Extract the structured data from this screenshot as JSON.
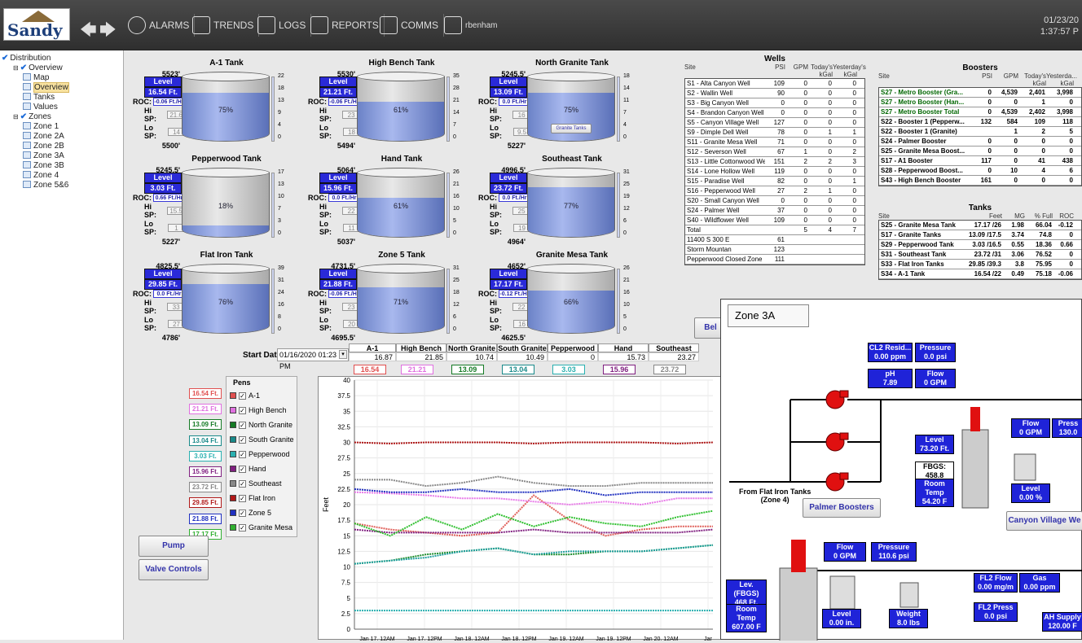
{
  "header": {
    "logo": "Sandy",
    "nav": [
      "ALARMS",
      "TRENDS",
      "LOGS",
      "REPORTS",
      "COMMS"
    ],
    "user": "rbenham",
    "date": "01/23/20",
    "time": "1:37:57 P"
  },
  "tree": [
    {
      "t": "Distribution",
      "lv": 0,
      "k": "check"
    },
    {
      "t": "Overview",
      "lv": 1,
      "k": "check"
    },
    {
      "t": "Map",
      "lv": 2,
      "k": "page"
    },
    {
      "t": "Overview",
      "lv": 2,
      "k": "page",
      "sel": true
    },
    {
      "t": "Tanks",
      "lv": 2,
      "k": "page"
    },
    {
      "t": "Values",
      "lv": 2,
      "k": "page"
    },
    {
      "t": "Zones",
      "lv": 1,
      "k": "check"
    },
    {
      "t": "Zone 1",
      "lv": 2,
      "k": "page"
    },
    {
      "t": "Zone 2A",
      "lv": 2,
      "k": "page"
    },
    {
      "t": "Zone 2B",
      "lv": 2,
      "k": "page"
    },
    {
      "t": "Zone 3A",
      "lv": 2,
      "k": "page"
    },
    {
      "t": "Zone 3B",
      "lv": 2,
      "k": "page"
    },
    {
      "t": "Zone 4",
      "lv": 2,
      "k": "page"
    },
    {
      "t": "Zone 5&6",
      "lv": 2,
      "k": "page"
    }
  ],
  "tanks": [
    {
      "name": "A-1 Tank",
      "top": "5523'",
      "level": "16.54 Ft.",
      "roc": "-0.06 Ft./Hr",
      "hisp": "21.6",
      "losp": "14",
      "bottom": "5500'",
      "pct": "75%",
      "fill": 0.75,
      "scale": [
        "22",
        "18",
        "13",
        "9",
        "4",
        "0"
      ]
    },
    {
      "name": "High Bench Tank",
      "top": "5530'",
      "level": "21.21 Ft.",
      "roc": "-0.06 Ft./Hr",
      "hisp": "23",
      "losp": "18",
      "bottom": "5494'",
      "pct": "61%",
      "fill": 0.61,
      "scale": [
        "35",
        "28",
        "21",
        "14",
        "7",
        "0"
      ]
    },
    {
      "name": "North Granite Tank",
      "top": "5245.5'",
      "level": "13.09 Ft.",
      "roc": "0.0 Ft./Hr",
      "hisp": "16",
      "losp": "9.5",
      "bottom": "5227'",
      "pct": "75%",
      "fill": 0.75,
      "scale": [
        "18",
        "14",
        "11",
        "7",
        "4",
        "0"
      ],
      "btn": "Granite Tanks"
    },
    {
      "name": "Pepperwood Tank",
      "top": "5245.5'",
      "level": "3.03 Ft.",
      "roc": "0.66 Ft./Hr",
      "hisp": "15.5",
      "losp": "1",
      "bottom": "5227'",
      "pct": "18%",
      "fill": 0.18,
      "scale": [
        "17",
        "13",
        "10",
        "7",
        "3",
        "0"
      ]
    },
    {
      "name": "Hand Tank",
      "top": "5064'",
      "level": "15.96 Ft.",
      "roc": "0.0 Ft./Hr",
      "hisp": "22",
      "losp": "11",
      "bottom": "5037'",
      "pct": "61%",
      "fill": 0.61,
      "scale": [
        "26",
        "21",
        "16",
        "10",
        "5",
        "0"
      ]
    },
    {
      "name": "Southeast Tank",
      "top": "4996.5'",
      "level": "23.72 Ft.",
      "roc": "0.0 Ft./Hr",
      "hisp": "25",
      "losp": "19",
      "bottom": "4964'",
      "pct": "77%",
      "fill": 0.77,
      "scale": [
        "31",
        "25",
        "19",
        "12",
        "6",
        "0"
      ]
    },
    {
      "name": "Flat Iron Tank",
      "top": "4825.5'",
      "level": "29.85 Ft.",
      "roc": "0.0 Ft./Hr",
      "hisp": "33",
      "losp": "27",
      "bottom": "4786'",
      "pct": "76%",
      "fill": 0.76,
      "scale": [
        "39",
        "31",
        "24",
        "16",
        "8",
        "0"
      ]
    },
    {
      "name": "Zone 5 Tank",
      "top": "4731.5'",
      "level": "21.88 Ft.",
      "roc": "-0.06 Ft./Hr",
      "hisp": "23",
      "losp": "20",
      "bottom": "4695.5'",
      "pct": "71%",
      "fill": 0.71,
      "scale": [
        "31",
        "25",
        "18",
        "12",
        "6",
        "0"
      ]
    },
    {
      "name": "Granite Mesa Tank",
      "top": "4652'",
      "level": "17.17 Ft.",
      "roc": "-0.12 Ft./Hr",
      "hisp": "22",
      "losp": "16",
      "bottom": "4625.5'",
      "pct": "66%",
      "fill": 0.66,
      "scale": [
        "26",
        "21",
        "16",
        "10",
        "5",
        "0"
      ]
    }
  ],
  "wells": {
    "title": "Wells",
    "hdr": [
      "Site",
      "PSI",
      "GPM",
      "Today's kGal",
      "Yesterday's kGal"
    ],
    "rows": [
      [
        "S1 - Alta Canyon Well",
        "109",
        "0",
        "0",
        "0"
      ],
      [
        "S2 - Wallin Well",
        "90",
        "0",
        "0",
        "0"
      ],
      [
        "S3 - Big Canyon Well",
        "0",
        "0",
        "0",
        "0"
      ],
      [
        "S4 - Brandon Canyon Well",
        "0",
        "0",
        "0",
        "0"
      ],
      [
        "S5 - Canyon Village Well",
        "127",
        "0",
        "0",
        "0"
      ],
      [
        "S9 - Dimple Dell Well",
        "78",
        "0",
        "1",
        "1"
      ],
      [
        "S11 - Granite Mesa Well",
        "71",
        "0",
        "0",
        "0"
      ],
      [
        "S12 - Severson Well",
        "67",
        "1",
        "0",
        "2"
      ],
      [
        "S13 - Little Cottonwood Well",
        "151",
        "2",
        "2",
        "3"
      ],
      [
        "S14 - Lone Hollow Well",
        "119",
        "0",
        "0",
        "0"
      ],
      [
        "S15 - Paradise Well",
        "82",
        "0",
        "0",
        "1"
      ],
      [
        "S16 - Pepperwood Well",
        "27",
        "2",
        "1",
        "0"
      ],
      [
        "S20 - Small Canyon Well",
        "0",
        "0",
        "0",
        "0"
      ],
      [
        "S24 - Palmer Well",
        "37",
        "0",
        "0",
        "0"
      ],
      [
        "S40 - Wildflower Well",
        "109",
        "0",
        "0",
        "0"
      ],
      [
        "Total",
        "",
        "5",
        "4",
        "7"
      ],
      [
        "11400 S 300 E",
        "61",
        "",
        "",
        ""
      ],
      [
        "Storm Mountan",
        "123",
        "",
        "",
        ""
      ],
      [
        "Pepperwood Closed Zone",
        "111",
        "",
        "",
        ""
      ]
    ]
  },
  "boosters": {
    "title": "Boosters",
    "hdr": [
      "Site",
      "PSI",
      "GPM",
      "Today's kGal",
      "Yesterda... kGal"
    ],
    "rows": [
      [
        "S27 - Metro Booster (Gra...",
        "0",
        "4,539",
        "2,401",
        "3,998"
      ],
      [
        "S27 - Metro Booster (Han...",
        "0",
        "0",
        "1",
        "0"
      ],
      [
        "S27 - Metro Booster Total",
        "0",
        "4,539",
        "2,402",
        "3,998"
      ],
      [
        "S22 - Booster 1 (Pepperw...",
        "132",
        "584",
        "109",
        "118"
      ],
      [
        "S22 - Booster 1 (Granite)",
        "",
        "1",
        "2",
        "5"
      ],
      [
        "S24 - Palmer Booster",
        "0",
        "0",
        "0",
        "0"
      ],
      [
        "S25 - Granite Mesa Boost...",
        "0",
        "0",
        "0",
        "0"
      ],
      [
        "S17 - A1 Booster",
        "117",
        "0",
        "41",
        "438"
      ],
      [
        "S28 - Pepperwood Boost...",
        "0",
        "10",
        "4",
        "6"
      ],
      [
        "S43 - High Bench Booster",
        "161",
        "0",
        "0",
        "0"
      ]
    ]
  },
  "tanks_tbl": {
    "title": "Tanks",
    "hdr": [
      "Site",
      "Feet",
      "MG",
      "% Full",
      "ROC"
    ],
    "rows": [
      [
        "S25 - Granite Mesa Tank",
        "17.17 /26",
        "1.98",
        "66.04",
        "-0.12"
      ],
      [
        "S17 - Granite Tanks",
        "13.09 /17.5",
        "3.74",
        "74.8",
        "0"
      ],
      [
        "S29 - Pepperwood Tank",
        "3.03 /16.5",
        "0.55",
        "18.36",
        "0.66"
      ],
      [
        "S31 - Southeast Tank",
        "23.72 /31",
        "3.06",
        "76.52",
        "0"
      ],
      [
        "S33 - Flat Iron Tanks",
        "29.85 /39.3",
        "3.8",
        "75.95",
        "0"
      ],
      [
        "S34 - A-1 Tank",
        "16.54 /22",
        "0.49",
        "75.18",
        "-0.06"
      ]
    ]
  },
  "trend": {
    "start_label": "Start Date:",
    "start_value": "01/16/2020 01:23 PM",
    "pens_label": "Pens",
    "ylabel": "Feet",
    "cols": [
      "A-1",
      "High Bench",
      "North Granite",
      "South Granite",
      "Pepperwood",
      "Hand",
      "Southeast"
    ],
    "avg": [
      "16.87",
      "21.85",
      "10.74",
      "10.49",
      "0",
      "15.73",
      "23.27"
    ],
    "cur": [
      "16.54",
      "21.21",
      "13.09",
      "13.04",
      "3.03",
      "15.96",
      "23.72"
    ]
  },
  "buttons": {
    "pump": "Pump Sequencing",
    "valve": "Valve Controls",
    "bel": "Bel"
  },
  "chart_data": {
    "type": "line",
    "ylabel": "Feet",
    "ylim": [
      0,
      40
    ],
    "yticks": [
      "0",
      "2.5",
      "5",
      "7.5",
      "10",
      "12.5",
      "15",
      "17.5",
      "20",
      "22.5",
      "25",
      "27.5",
      "30",
      "32.5",
      "35",
      "37.5",
      "40"
    ],
    "xticks": [
      "Jan 17, 12AM",
      "Jan 17, 12PM",
      "Jan 18, 12AM",
      "Jan 18, 12PM",
      "Jan 19, 12AM",
      "Jan 19, 12PM",
      "Jan 20, 12AM",
      "Jar"
    ],
    "series": [
      {
        "name": "A-1",
        "color": "#e0605a",
        "values": [
          17,
          16,
          15.5,
          15,
          15.5,
          21.5,
          17.5,
          15,
          16,
          16.5,
          16.5
        ]
      },
      {
        "name": "High Bench",
        "color": "#e87ae8",
        "values": [
          22,
          21.8,
          21.5,
          21,
          21,
          20.5,
          20,
          20.5,
          20,
          21,
          21
        ]
      },
      {
        "name": "North Granite",
        "color": "#1a8a2a",
        "values": [
          10.5,
          11,
          12,
          12.5,
          13,
          12,
          12,
          12.5,
          12.5,
          13,
          13.5
        ]
      },
      {
        "name": "South Granite",
        "color": "#22a0a0",
        "values": [
          10.5,
          11,
          11.5,
          12.5,
          13,
          12,
          12.5,
          12.5,
          12.5,
          13,
          13.5
        ]
      },
      {
        "name": "Pepperwood",
        "color": "#2ab0b0",
        "values": [
          3,
          3,
          3,
          3,
          3,
          3,
          3,
          3,
          3,
          3,
          3
        ]
      },
      {
        "name": "Hand",
        "color": "#802080",
        "values": [
          16,
          15.5,
          15.5,
          15.5,
          15.5,
          16,
          15.5,
          15.5,
          15.5,
          15.5,
          16
        ]
      },
      {
        "name": "Southeast",
        "color": "#888888",
        "values": [
          24,
          24,
          23,
          23.5,
          24.5,
          23.5,
          23,
          23,
          23.5,
          23.5,
          23.5
        ]
      },
      {
        "name": "Flat Iron",
        "color": "#b01818",
        "values": [
          30,
          29.8,
          30,
          30,
          30,
          29.8,
          30,
          30,
          30,
          29.8,
          30
        ]
      },
      {
        "name": "Zone 5",
        "color": "#2030c0",
        "values": [
          22.5,
          22,
          22,
          22.5,
          22,
          22,
          22.5,
          21.5,
          22,
          22,
          22
        ]
      },
      {
        "name": "Granite Mesa",
        "color": "#30c030",
        "values": [
          17,
          15,
          18,
          16,
          18.5,
          16.5,
          18,
          17,
          16.5,
          18,
          19
        ]
      }
    ]
  },
  "pens": [
    {
      "name": "A-1",
      "val": "16.54 Ft.",
      "color": "#e05050"
    },
    {
      "name": "High Bench",
      "val": "21.21 Ft.",
      "color": "#e070e0"
    },
    {
      "name": "North Granite",
      "val": "13.09 Ft.",
      "color": "#157a25"
    },
    {
      "name": "South Granite",
      "val": "13.04 Ft.",
      "color": "#1a8a8a"
    },
    {
      "name": "Pepperwood",
      "val": "3.03 Ft.",
      "color": "#2ab0b0"
    },
    {
      "name": "Hand",
      "val": "15.96 Ft.",
      "color": "#802080"
    },
    {
      "name": "Southeast",
      "val": "23.72 Ft.",
      "color": "#888888"
    },
    {
      "name": "Flat Iron",
      "val": "29.85 Ft.",
      "color": "#b01818"
    },
    {
      "name": "Zone 5",
      "val": "21.88 Ft.",
      "color": "#2030c0"
    },
    {
      "name": "Granite Mesa",
      "val": "17.17 Ft.",
      "color": "#30b030"
    }
  ],
  "zone": {
    "title": "Zone 3A",
    "cl2_l": "CL2 Resid...",
    "cl2_v": "0.00 ppm",
    "press_l": "Pressure",
    "press_v": "0.0 psi",
    "ph_l": "pH",
    "ph_v": "7.89",
    "flow_l": "Flow",
    "flow_v": "0 GPM",
    "level_l": "Level",
    "level_v": "73.20 Ft.",
    "fbgs": "FBGS: 458.8",
    "rt_l": "Room Temp",
    "rt_v": "54.20 F",
    "from1": "From Flat Iron Tanks",
    "from2": "(Zone 4)",
    "palmer": "Palmer Boosters",
    "flow2_l": "Flow",
    "flow2_v": "0 GPM",
    "press2_l": "Press",
    "press2_v": "130.0",
    "lvl2_l": "Level",
    "lvl2_v": "0.00 %",
    "canyon": "Canyon Village We",
    "flow3_l": "Flow",
    "flow3_v": "0 GPM",
    "press3_l": "Pressure",
    "press3_v": "110.6 psi",
    "lev_l": "Lev. (FBGS)",
    "lev_v": "468 Ft.",
    "rt2_l": "Room Temp",
    "rt2_v": "607.00 F",
    "lvl3_l": "Level",
    "lvl3_v": "0.00 in.",
    "wt_l": "Weight",
    "wt_v": "8.0 lbs",
    "fl2_l": "FL2 Flow",
    "fl2_v": "0.00 mg/m",
    "gas_l": "Gas",
    "gas_v": "0.00 ppm",
    "fl2p_l": "FL2 Press",
    "fl2p_v": "0.0 psi",
    "ah_l": "AH Supply",
    "ah_v": "120.00 F"
  }
}
